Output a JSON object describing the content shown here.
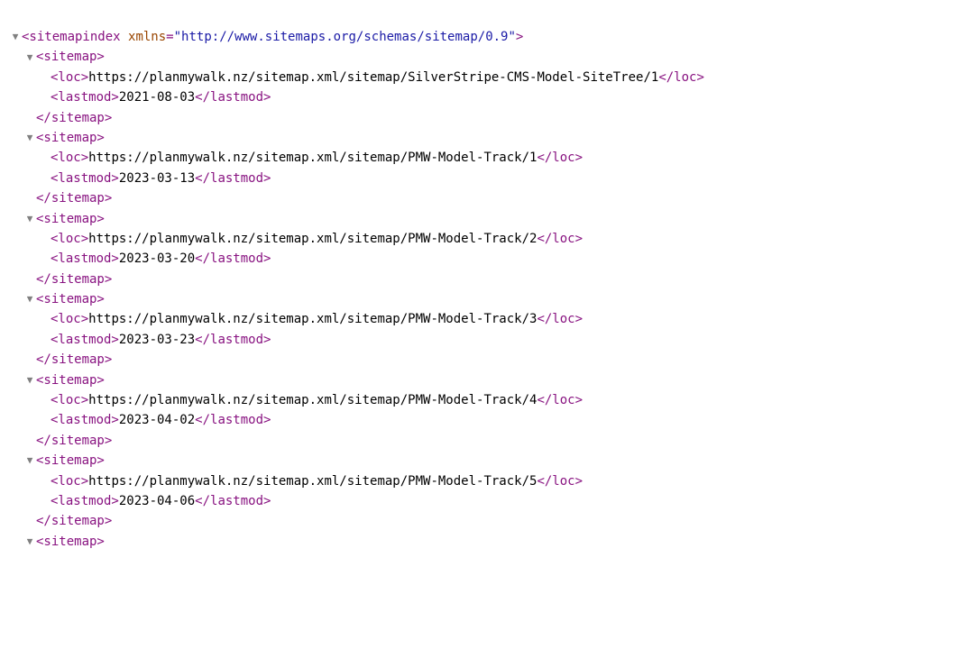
{
  "root": {
    "tagName": "sitemapindex",
    "attrName": "xmlns",
    "attrValue": "http://www.sitemaps.org/schemas/sitemap/0.9"
  },
  "sitemapTag": "sitemap",
  "locTag": "loc",
  "lastmodTag": "lastmod",
  "entries": [
    {
      "loc": "https://planmywalk.nz/sitemap.xml/sitemap/SilverStripe-CMS-Model-SiteTree/1",
      "lastmod": "2021-08-03"
    },
    {
      "loc": "https://planmywalk.nz/sitemap.xml/sitemap/PMW-Model-Track/1",
      "lastmod": "2023-03-13"
    },
    {
      "loc": "https://planmywalk.nz/sitemap.xml/sitemap/PMW-Model-Track/2",
      "lastmod": "2023-03-20"
    },
    {
      "loc": "https://planmywalk.nz/sitemap.xml/sitemap/PMW-Model-Track/3",
      "lastmod": "2023-03-23"
    },
    {
      "loc": "https://planmywalk.nz/sitemap.xml/sitemap/PMW-Model-Track/4",
      "lastmod": "2023-04-02"
    },
    {
      "loc": "https://planmywalk.nz/sitemap.xml/sitemap/PMW-Model-Track/5",
      "lastmod": "2023-04-06"
    }
  ],
  "trailingOpen": true
}
